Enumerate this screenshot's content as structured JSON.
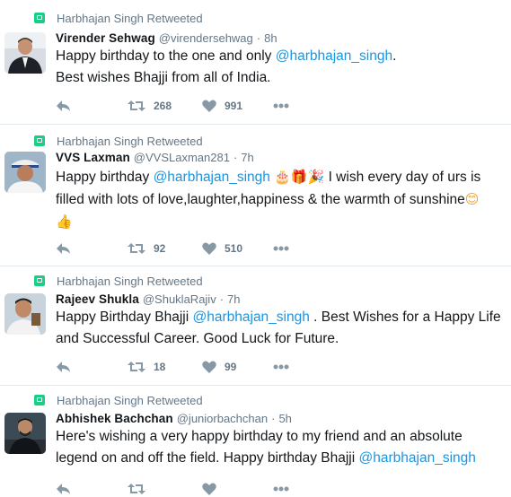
{
  "retweet_label": "Harbhajan Singh Retweeted",
  "tweets": [
    {
      "name": "Virender Sehwag",
      "handle": "@virendersehwag",
      "time": "8h",
      "text_parts": [
        "Happy birthday to the one and only ",
        "@harbhajan_singh",
        ".",
        "Best wishes Bhajji from all of India."
      ],
      "retweets": "268",
      "likes": "991"
    },
    {
      "name": "VVS Laxman",
      "handle": "@VVSLaxman281",
      "time": "7h",
      "text_parts": [
        "Happy  birthday ",
        "@harbhajan_singh",
        " ",
        "🎂🎁🎉",
        " I wish every day of urs is filled with lots of love,laughter,happiness & the warmth of sunshine",
        "😊",
        "👍"
      ],
      "retweets": "92",
      "likes": "510"
    },
    {
      "name": "Rajeev Shukla",
      "handle": "@ShuklaRajiv",
      "time": "7h",
      "text_parts": [
        "Happy Birthday Bhajji ",
        "@harbhajan_singh",
        " . Best Wishes for a Happy Life and Successful Career. Good Luck for Future."
      ],
      "retweets": "18",
      "likes": "99"
    },
    {
      "name": "Abhishek Bachchan",
      "handle": "@juniorbachchan",
      "time": "5h",
      "text_parts": [
        "Here's wishing a very happy birthday to my friend and an absolute legend on and off the field. Happy birthday Bhajji ",
        "@harbhajan_singh"
      ],
      "retweets": "",
      "likes": ""
    }
  ],
  "colors": {
    "mention": "#1b95e0",
    "retweet_green": "#19cf86",
    "muted": "#657786"
  },
  "icons": {
    "retweeted": "retweet-icon",
    "reply": "reply-icon",
    "retweet": "retweet-icon",
    "like": "heart-icon",
    "more": "more-icon"
  }
}
